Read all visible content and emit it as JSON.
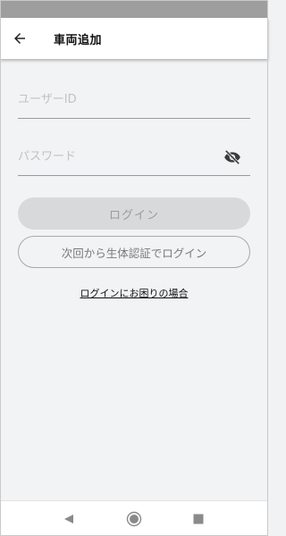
{
  "app_bar": {
    "title": "車両追加",
    "back_icon": "arrow-left-icon"
  },
  "login_form": {
    "user_id": {
      "placeholder": "ユーザーID",
      "value": ""
    },
    "password": {
      "placeholder": "パスワード",
      "value": "",
      "toggle_icon": "eye-off-icon"
    },
    "login_button_label": "ログイン",
    "biometric_button_label": "次回から生体認証でログイン",
    "help_link_label": "ログインにお困りの場合"
  },
  "nav_bar": {
    "icons": [
      "triangle-back-icon",
      "circle-home-icon",
      "square-recents-icon"
    ]
  },
  "colors": {
    "status_bar": "#9e9e9e",
    "background": "#f1f3f5",
    "disabled_button": "#d8d9db",
    "disabled_text": "#9b9b9b"
  }
}
